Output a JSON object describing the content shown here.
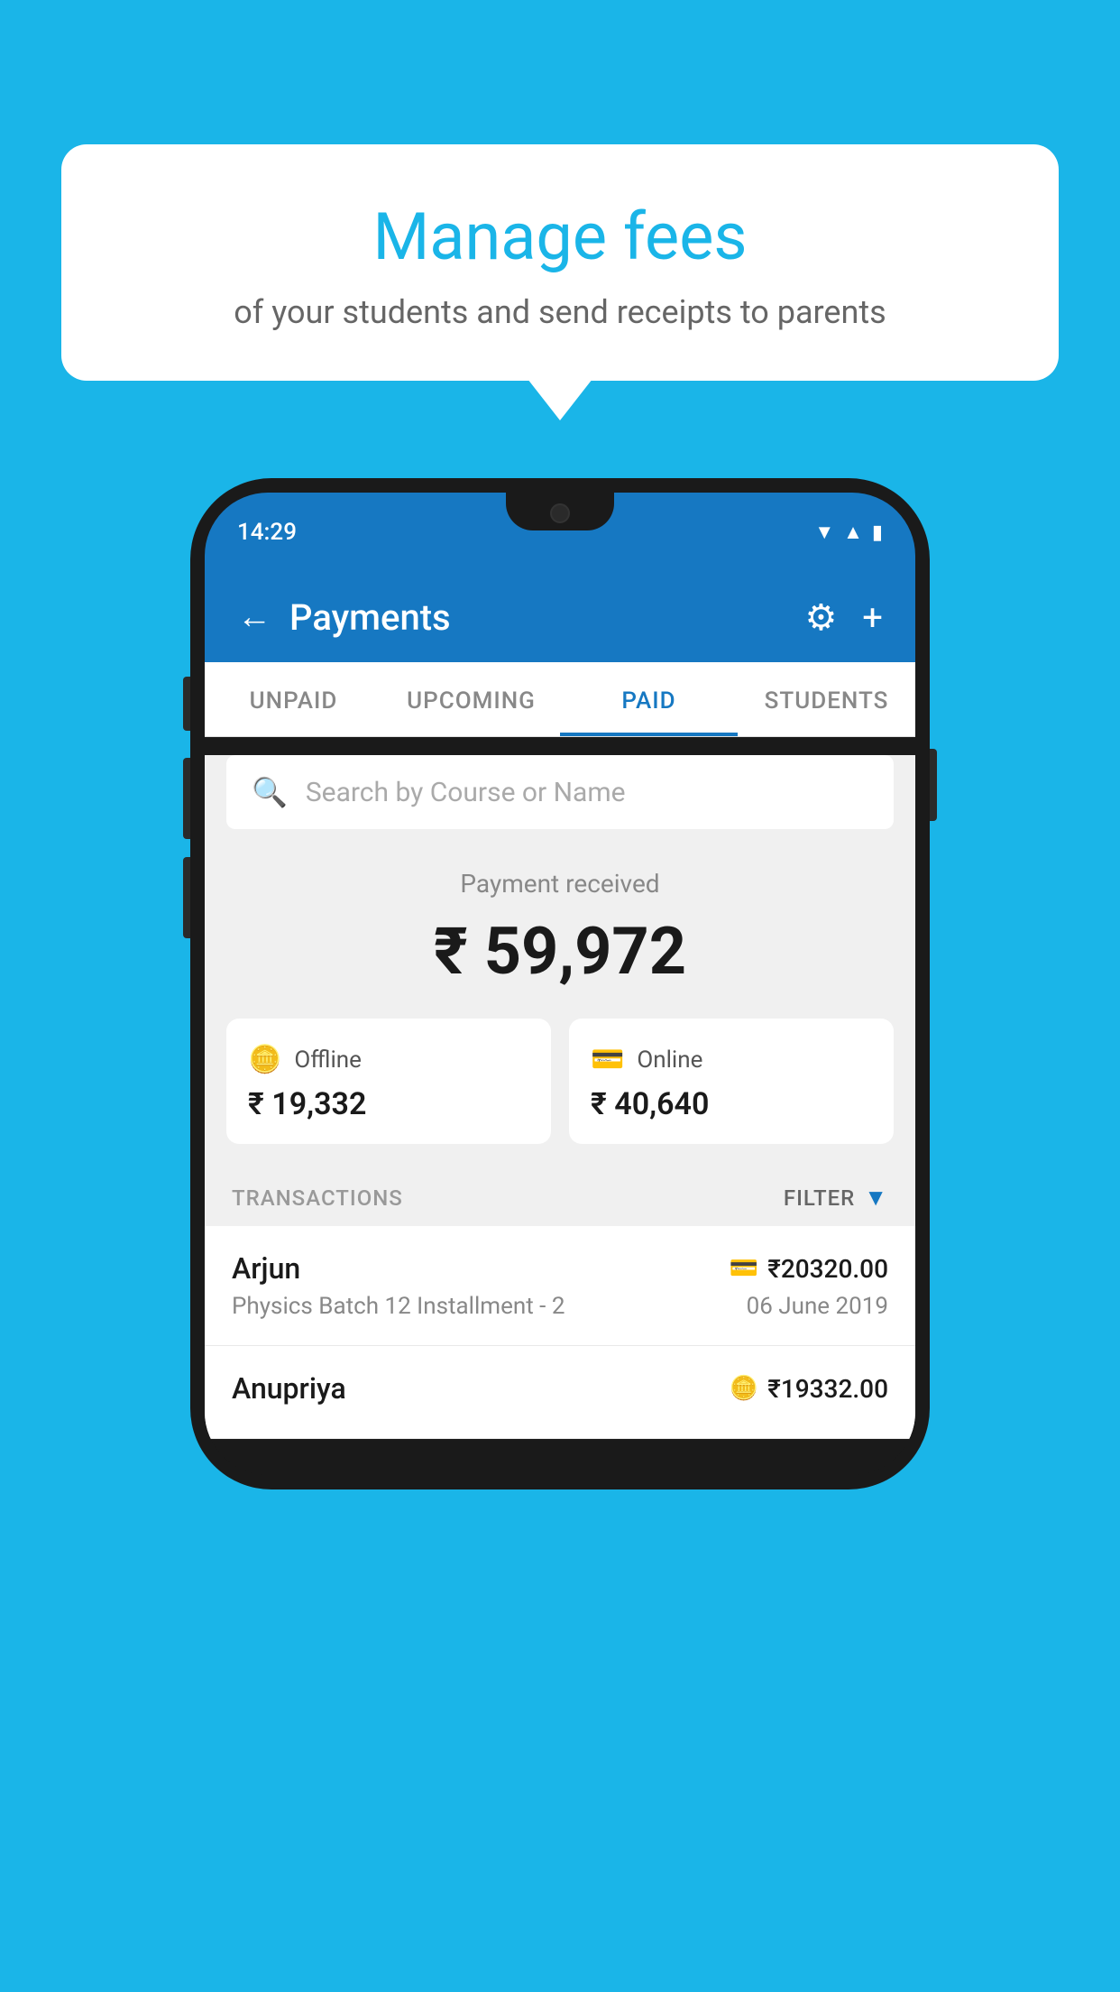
{
  "background_color": "#1ab5e8",
  "speech_bubble": {
    "title": "Manage fees",
    "subtitle": "of your students and send receipts to parents"
  },
  "phone": {
    "status_bar": {
      "time": "14:29"
    },
    "header": {
      "title": "Payments",
      "back_label": "←"
    },
    "tabs": [
      {
        "label": "UNPAID",
        "active": false
      },
      {
        "label": "UPCOMING",
        "active": false
      },
      {
        "label": "PAID",
        "active": true
      },
      {
        "label": "STUDENTS",
        "active": false
      }
    ],
    "search": {
      "placeholder": "Search by Course or Name"
    },
    "payment_received": {
      "label": "Payment received",
      "amount": "₹ 59,972"
    },
    "payment_cards": [
      {
        "label": "Offline",
        "amount": "₹ 19,332",
        "icon": "offline"
      },
      {
        "label": "Online",
        "amount": "₹ 40,640",
        "icon": "online"
      }
    ],
    "transactions_label": "TRANSACTIONS",
    "filter_label": "FILTER",
    "transactions": [
      {
        "name": "Arjun",
        "course": "Physics Batch 12 Installment - 2",
        "amount": "₹20320.00",
        "date": "06 June 2019",
        "icon": "card"
      },
      {
        "name": "Anupriya",
        "course": "",
        "amount": "₹19332.00",
        "date": "",
        "icon": "offline"
      }
    ]
  }
}
